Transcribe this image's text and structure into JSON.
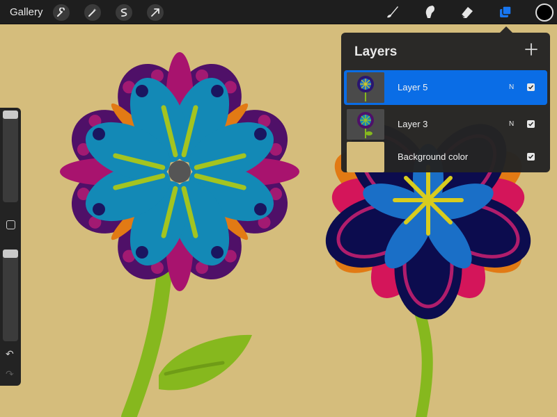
{
  "toolbar": {
    "gallery_label": "Gallery",
    "tools": [
      "wrench-icon",
      "magic-wand-icon",
      "selection-icon",
      "transform-arrow-icon"
    ],
    "brush_tools": [
      "brush-icon",
      "smudge-icon",
      "eraser-icon",
      "layers-icon"
    ],
    "accent_color": "#1877f2",
    "current_color": "#000000"
  },
  "layers": {
    "title": "Layers",
    "items": [
      {
        "name": "Layer 5",
        "blend": "N",
        "visible": true,
        "active": true
      },
      {
        "name": "Layer 3",
        "blend": "N",
        "visible": true,
        "active": false
      },
      {
        "name": "Background color",
        "blend": "",
        "visible": true,
        "active": false
      }
    ]
  },
  "canvas": {
    "background_color": "#d5bd7c"
  }
}
